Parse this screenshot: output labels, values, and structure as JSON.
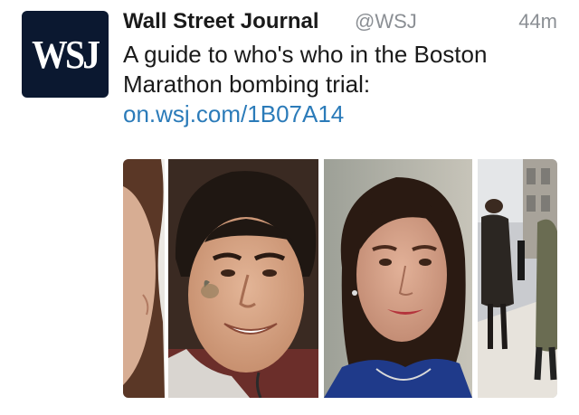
{
  "tweet": {
    "display_name": "Wall Street Journal",
    "handle": "@WSJ",
    "timestamp": "44m",
    "avatar_text": "WSJ",
    "text_prefix": "A guide to who's who in the Boston Marathon bombing trial: ",
    "link_text": "on.wsj.com/1B07A14"
  },
  "media": {
    "description_items": [
      "photo-panel-1",
      "photo-panel-2",
      "photo-panel-3",
      "photo-panel-4"
    ]
  },
  "colors": {
    "avatar_bg": "#0b1830",
    "link": "#2b7bb9",
    "muted": "#8b8f94"
  }
}
